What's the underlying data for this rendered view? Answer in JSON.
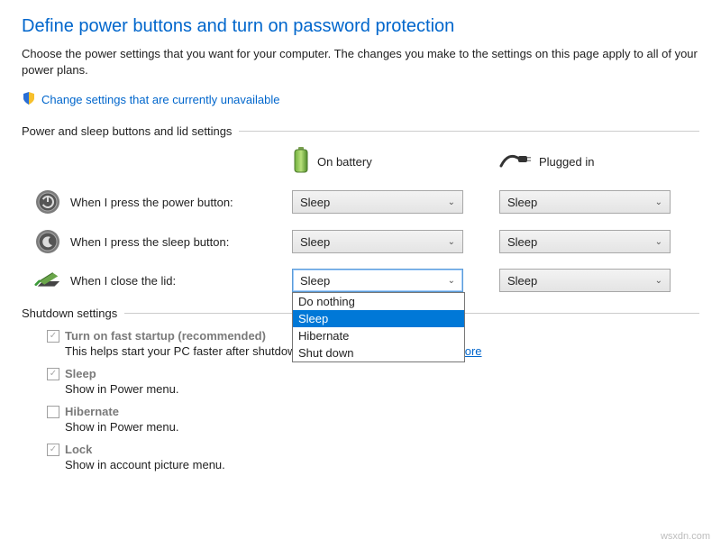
{
  "page_title": "Define power buttons and turn on password protection",
  "intro": "Choose the power settings that you want for your computer. The changes you make to the settings on this page apply to all of your power plans.",
  "change_link": "Change settings that are currently unavailable",
  "section_buttons": {
    "header": "Power and sleep buttons and lid settings",
    "col_battery": "On battery",
    "col_plugged": "Plugged in",
    "rows": [
      {
        "label": "When I press the power button:",
        "battery": "Sleep",
        "plugged": "Sleep"
      },
      {
        "label": "When I press the sleep button:",
        "battery": "Sleep",
        "plugged": "Sleep"
      },
      {
        "label": "When I close the lid:",
        "battery": "Sleep",
        "plugged": "Sleep"
      }
    ],
    "lid_options": [
      "Do nothing",
      "Sleep",
      "Hibernate",
      "Shut down"
    ],
    "lid_selected": "Sleep"
  },
  "section_shutdown": {
    "header": "Shutdown settings",
    "items": [
      {
        "checked": true,
        "title": "Turn on fast startup (recommended)",
        "desc_prefix": "This helps start your PC faster after shutdown. Restart isn't affected. ",
        "learn": "Learn More"
      },
      {
        "checked": true,
        "title": "Sleep",
        "desc": "Show in Power menu."
      },
      {
        "checked": false,
        "title": "Hibernate",
        "desc": "Show in Power menu."
      },
      {
        "checked": true,
        "title": "Lock",
        "desc": "Show in account picture menu."
      }
    ]
  },
  "watermark": "wsxdn.com"
}
